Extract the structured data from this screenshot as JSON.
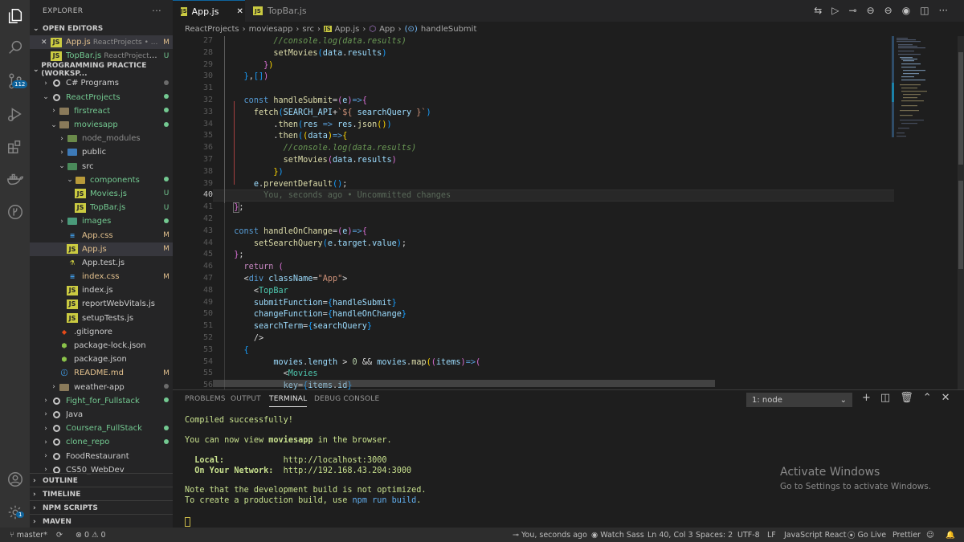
{
  "explorer": {
    "title": "EXPLORER",
    "more": "···",
    "open_editors_label": "OPEN EDITORS",
    "open_editors": [
      {
        "name": "App.js",
        "path": "ReactProjects • ...",
        "status": "M",
        "close": "✕"
      },
      {
        "name": "TopBar.js",
        "path": "ReactProjects ...",
        "status": "U"
      }
    ],
    "workspace_label": "PROGRAMMING PRACTICE (WORKSP...",
    "tree": [
      {
        "label": "C# Programs",
        "status": ""
      },
      {
        "label": "ReactProjects",
        "status": ""
      },
      {
        "label": "firstreact",
        "status": ""
      },
      {
        "label": "moviesapp",
        "status": ""
      },
      {
        "label": "node_modules",
        "status": ""
      },
      {
        "label": "public",
        "status": ""
      },
      {
        "label": "src",
        "status": ""
      },
      {
        "label": "components",
        "status": ""
      },
      {
        "label": "Movies.js",
        "status": "U"
      },
      {
        "label": "TopBar.js",
        "status": "U"
      },
      {
        "label": "images",
        "status": ""
      },
      {
        "label": "App.css",
        "status": "M"
      },
      {
        "label": "App.js",
        "status": "M"
      },
      {
        "label": "App.test.js",
        "status": ""
      },
      {
        "label": "index.css",
        "status": "M"
      },
      {
        "label": "index.js",
        "status": ""
      },
      {
        "label": "reportWebVitals.js",
        "status": ""
      },
      {
        "label": "setupTests.js",
        "status": ""
      },
      {
        "label": ".gitignore",
        "status": ""
      },
      {
        "label": "package-lock.json",
        "status": ""
      },
      {
        "label": "package.json",
        "status": ""
      },
      {
        "label": "README.md",
        "status": "M"
      },
      {
        "label": "weather-app",
        "status": ""
      },
      {
        "label": "Fight_for_Fullstack",
        "status": ""
      },
      {
        "label": "Java",
        "status": ""
      },
      {
        "label": "Coursera_FullStack",
        "status": ""
      },
      {
        "label": "clone_repo",
        "status": ""
      },
      {
        "label": "FoodRestaurant",
        "status": ""
      },
      {
        "label": "CS50_WebDev",
        "status": ""
      }
    ],
    "outline": "OUTLINE",
    "timeline": "TIMELINE",
    "npm_scripts": "NPM SCRIPTS",
    "maven": "MAVEN",
    "scm_badge": "112",
    "settings_badge": "1"
  },
  "tabs": [
    {
      "name": "App.js",
      "active": true,
      "close": "✕"
    },
    {
      "name": "TopBar.js",
      "active": false
    }
  ],
  "breadcrumb": [
    "ReactProjects",
    "moviesapp",
    "src",
    "App.js",
    "App",
    "handleSubmit"
  ],
  "breadcrumb_sep": "›",
  "editor": {
    "line_numbers": [
      "27",
      "28",
      "29",
      "30",
      "31",
      "32",
      "33",
      "34",
      "35",
      "36",
      "37",
      "38",
      "39",
      "40",
      "41",
      "42",
      "43",
      "44",
      "45",
      "46",
      "47",
      "48",
      "49",
      "50",
      "51",
      "52",
      "53",
      "54",
      "55",
      "56"
    ],
    "blame": "You, seconds ago • Uncommitted changes"
  },
  "panel": {
    "tabs": [
      "PROBLEMS",
      "OUTPUT",
      "TERMINAL",
      "DEBUG CONSOLE"
    ],
    "active_tab": "TERMINAL",
    "terminal_select": "1: node",
    "terminal_lines": {
      "compiled": "Compiled successfully!",
      "view_prefix": "You can now view ",
      "app_name": "moviesapp",
      "view_suffix": " in the browser.",
      "local_label": "  Local:            ",
      "local_url": "http://localhost:3000",
      "network_label": "  On Your Network:  ",
      "network_url": "http://192.168.43.204:3000",
      "note": "Note that the development build is not optimized.",
      "prod_prefix": "To create a production build, use ",
      "prod_cmd": "npm run build",
      "prod_suffix": "."
    }
  },
  "watermark": {
    "title": "Activate Windows",
    "subtitle": "Go to Settings to activate Windows."
  },
  "statusbar": {
    "branch": "master*",
    "errors": "0",
    "warnings": "0",
    "blame": "You, seconds ago",
    "watch_sass": "Watch Sass",
    "position": "Ln 40, Col 3",
    "spaces": "Spaces: 2",
    "encoding": "UTF-8",
    "eol": "LF",
    "language": "JavaScript React",
    "go_live": "Go Live",
    "prettier": "Prettier"
  },
  "colors": {
    "accent_blue": "#0e639c",
    "modified": "#e2c08d",
    "untracked": "#73c991",
    "terminal_green": "#c8e18e"
  }
}
